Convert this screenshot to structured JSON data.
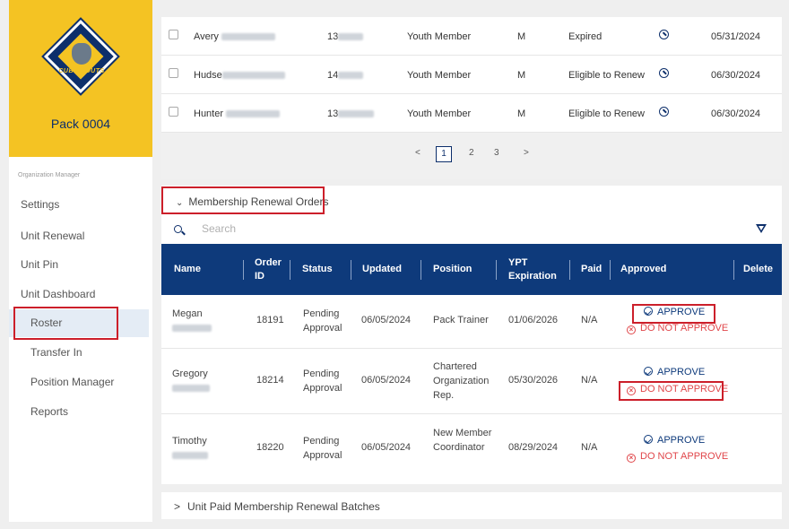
{
  "sidebar": {
    "logo_text": "CUB SCOUTS",
    "pack_name": "Pack 0004",
    "section_label": "Organization Manager",
    "items": [
      "Settings",
      "Unit Renewal",
      "Unit Pin",
      "Unit Dashboard",
      "Roster",
      "Transfer In",
      "Position Manager",
      "Reports"
    ]
  },
  "members": [
    {
      "first": "Avery",
      "id": "13",
      "type": "Youth Member",
      "gender": "M",
      "status": "Expired",
      "date": "05/31/2024"
    },
    {
      "first": "Hudse",
      "id": "14",
      "type": "Youth Member",
      "gender": "M",
      "status": "Eligible to Renew",
      "date": "06/30/2024"
    },
    {
      "first": "Hunter",
      "id": "13",
      "type": "Youth Member",
      "gender": "M",
      "status": "Eligible to Renew",
      "date": "06/30/2024"
    }
  ],
  "pagination": {
    "prev": "<",
    "pages": [
      "1",
      "2",
      "3"
    ],
    "next": ">"
  },
  "renewal": {
    "title": "Membership Renewal Orders",
    "search_placeholder": "Search",
    "headers": {
      "name": "Name",
      "order_id": "Order ID",
      "status": "Status",
      "updated": "Updated",
      "position": "Position",
      "ypt": "YPT Expiration",
      "paid": "Paid",
      "approved": "Approved",
      "delete": "Delete"
    },
    "approve_label": "APPROVE",
    "deny_label": "DO NOT APPROVE",
    "orders": [
      {
        "name": "Megan",
        "order_id": "18191",
        "status": "Pending Approval",
        "updated": "06/05/2024",
        "position": "Pack Trainer",
        "ypt": "01/06/2026",
        "paid": "N/A"
      },
      {
        "name": "Gregory",
        "order_id": "18214",
        "status": "Pending Approval",
        "updated": "06/05/2024",
        "position": "Chartered Organization Rep.",
        "ypt": "05/30/2026",
        "paid": "N/A"
      },
      {
        "name": "Timothy",
        "order_id": "18220",
        "status": "Pending Approval",
        "updated": "06/05/2024",
        "position": "New Member Coordinator",
        "ypt": "08/29/2024",
        "paid": "N/A"
      }
    ]
  },
  "batches": {
    "title": "Unit Paid Membership Renewal Batches"
  }
}
